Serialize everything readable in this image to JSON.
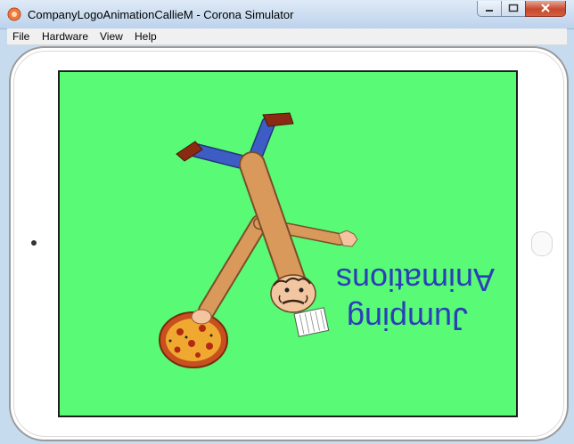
{
  "window": {
    "title": "CompanyLogoAnimationCallieM - Corona Simulator"
  },
  "menu": {
    "items": [
      "File",
      "Hardware",
      "View",
      "Help"
    ]
  },
  "canvas": {
    "text_line1": "Animations",
    "text_line2": "Jumping",
    "background_color": "#59fa75",
    "text_color": "#2b3fb8"
  },
  "icons": {
    "app": "corona-app-icon",
    "minimize": "minimize-icon",
    "maximize": "maximize-icon",
    "close": "close-icon"
  }
}
